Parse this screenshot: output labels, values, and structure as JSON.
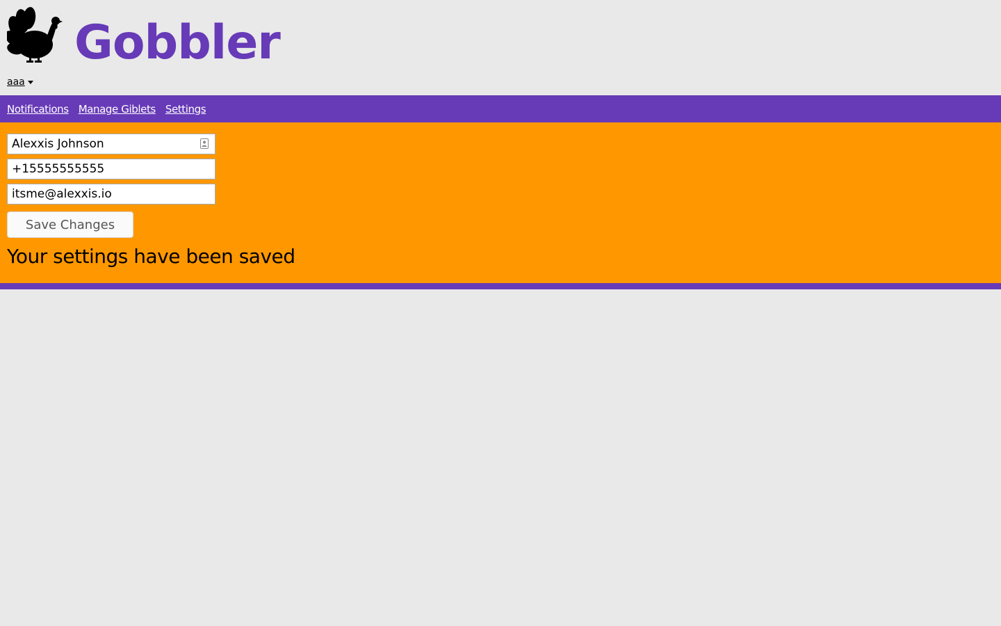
{
  "app": {
    "title": "Gobbler",
    "logo_icon": "turkey-icon"
  },
  "colors": {
    "brand_purple": "#673ab7",
    "panel_orange": "#ff9800",
    "page_background": "#e9e9e9"
  },
  "user_menu": {
    "label": "aaa",
    "icon": "caret-down-icon"
  },
  "nav": {
    "items": [
      {
        "label": "Notifications"
      },
      {
        "label": "Manage Giblets"
      },
      {
        "label": "Settings"
      }
    ]
  },
  "settings_form": {
    "name_value": "Alexxis Johnson",
    "name_field_icon": "contact-card-icon",
    "phone_value": "+15555555555",
    "email_value": "itsme@alexxis.io",
    "save_label": "Save Changes"
  },
  "status": {
    "message": "Your settings have been saved"
  }
}
